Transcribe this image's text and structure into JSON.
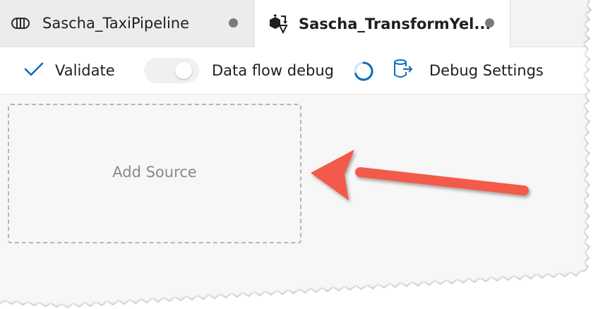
{
  "tabs": [
    {
      "label": "Sascha_TaxiPipeline",
      "icon": "pipeline-icon",
      "active": false,
      "unsaved": true
    },
    {
      "label": "Sascha_TransformYel...",
      "icon": "data-flow-icon",
      "active": true,
      "unsaved": true
    }
  ],
  "toolbar": {
    "validate_label": "Validate",
    "debug_toggle_label": "Data flow debug",
    "debug_settings_label": "Debug Settings"
  },
  "canvas": {
    "add_source_label": "Add Source"
  },
  "colors": {
    "accent": "#0f6cbd",
    "arrow": "#f35a4a"
  }
}
